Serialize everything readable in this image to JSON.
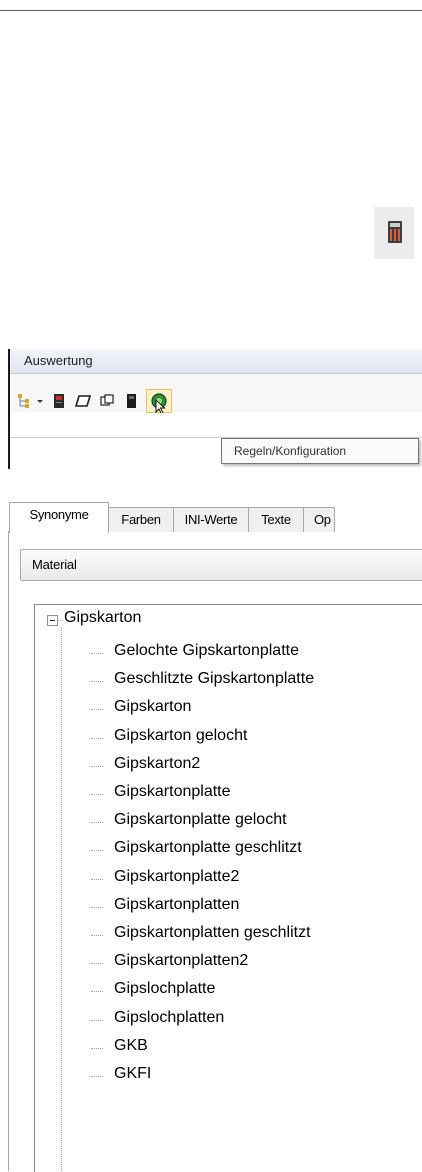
{
  "toolbar_panel": {
    "title": "Auswertung",
    "tooltip": "Regeln/Konfiguration",
    "buttons": [
      "hierarchy-dropdown-icon",
      "book-red-icon",
      "card-icon",
      "copy-icon",
      "book-icon",
      "rules-config-icon"
    ]
  },
  "tabs": [
    "Synonyme",
    "Farben",
    "INI-Werte",
    "Texte",
    "Op"
  ],
  "active_tab": "Synonyme",
  "dropdown": {
    "value": "Material"
  },
  "tree": {
    "root": "Gipskarton",
    "children": [
      "Gelochte Gipskartonplatte",
      "Geschlitzte Gipskartonplatte",
      "Gipskarton",
      "Gipskarton gelocht",
      "Gipskarton2",
      "Gipskartonplatte",
      "Gipskartonplatte gelocht",
      "Gipskartonplatte geschlitzt",
      "Gipskartonplatte2",
      "Gipskartonplatten",
      "Gipskartonplatten geschlitzt",
      "Gipskartonplatten2",
      "Gipslochplatte",
      "Gipslochplatten",
      "GKB",
      "GKFI"
    ]
  }
}
